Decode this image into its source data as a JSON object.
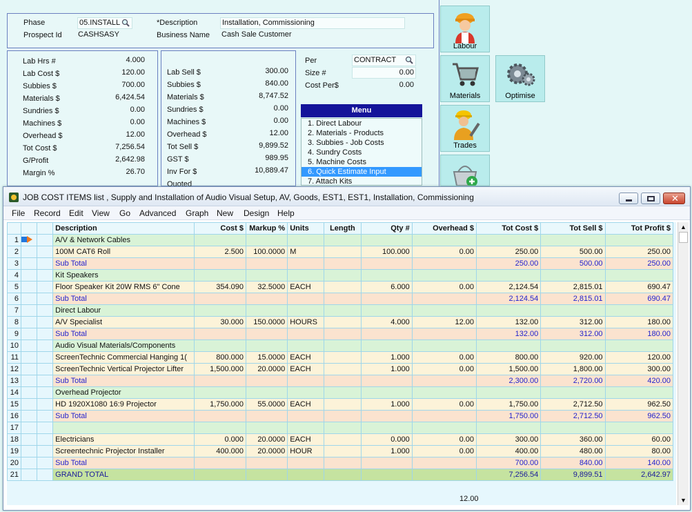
{
  "header": {
    "phase_label": "Phase",
    "phase_value": "05.INSTALL",
    "prospect_label": "Prospect Id",
    "prospect_value": "CASHSASY",
    "desc_label": "*Description",
    "desc_value": "Installation, Commissioning",
    "business_label": "Business Name",
    "business_value": "Cash Sale Customer"
  },
  "costs": [
    {
      "label": "Lab Hrs #",
      "value": "4.000"
    },
    {
      "label": "Lab Cost $",
      "value": "120.00"
    },
    {
      "label": "Subbies  $",
      "value": "700.00"
    },
    {
      "label": "Materials $",
      "value": "6,424.54"
    },
    {
      "label": "Sundries  $",
      "value": "0.00"
    },
    {
      "label": "Machines $",
      "value": "0.00"
    },
    {
      "label": "Overhead $",
      "value": "12.00"
    },
    {
      "label": "Tot Cost $",
      "value": "7,256.54"
    },
    {
      "label": "G/Profit",
      "value": "2,642.98"
    },
    {
      "label": "Margin %",
      "value": "26.70"
    }
  ],
  "sells": [
    {
      "label": "Lab Sell $",
      "value": "300.00"
    },
    {
      "label": "Subbies  $",
      "value": "840.00"
    },
    {
      "label": "Materials $",
      "value": "8,747.52"
    },
    {
      "label": "Sundries  $",
      "value": "0.00"
    },
    {
      "label": "Machines $",
      "value": "0.00"
    },
    {
      "label": "Overhead $",
      "value": "12.00"
    },
    {
      "label": "Tot Sell $",
      "value": "9,899.52"
    },
    {
      "label": "GST  $",
      "value": "989.95"
    },
    {
      "label": "Inv For $",
      "value": "10,889.47"
    },
    {
      "label": "Quoted",
      "value": ""
    }
  ],
  "per": {
    "per_label": "Per",
    "per_value": "CONTRACT",
    "size_label": "Size #",
    "size_value": "0.00",
    "costper_label": "Cost Per$",
    "costper_value": "0.00"
  },
  "menu": {
    "title": "Menu",
    "items": [
      "1. Direct Labour",
      "2. Materials - Products",
      "3. Subbies - Job Costs",
      "4. Sundry Costs",
      "5. Machine Costs",
      "6. Quick Estimate Input",
      "7. Attach Kits"
    ],
    "selected_index": 5
  },
  "side_buttons": {
    "labour": "Labour",
    "materials": "Materials",
    "optimise": "Optimise",
    "trades": "Trades"
  },
  "window": {
    "title": "JOB COST ITEMS list , Supply and Installation of Audio Visual Setup, AV, Goods, EST1, EST1, Installation, Commissioning",
    "menubar": [
      "File",
      "Record",
      "Edit",
      "View",
      "Go",
      "Advanced",
      "Graph",
      "New",
      "Design",
      "Help"
    ]
  },
  "grid": {
    "columns": [
      "Description",
      "Cost $",
      "Markup %",
      "Units",
      "Length",
      "Qty #",
      "Overhead $",
      "Tot Cost $",
      "Tot Sell $",
      "Tot Profit $"
    ],
    "rows": [
      {
        "n": "1",
        "type": "cat",
        "desc": "A/V & Network Cables",
        "cost": "",
        "markup": "",
        "units": "",
        "length": "",
        "qty": "",
        "overhead": "",
        "totcost": "",
        "totsell": "",
        "profit": ""
      },
      {
        "n": "2",
        "type": "item",
        "desc": "100M CAT6 Roll",
        "cost": "2.500",
        "markup": "100.0000",
        "units": "M",
        "length": "",
        "qty": "100.000",
        "overhead": "0.00",
        "totcost": "250.00",
        "totsell": "500.00",
        "profit": "250.00"
      },
      {
        "n": "3",
        "type": "sub",
        "desc": "Sub Total",
        "cost": "",
        "markup": "",
        "units": "",
        "length": "",
        "qty": "",
        "overhead": "",
        "totcost": "250.00",
        "totsell": "500.00",
        "profit": "250.00"
      },
      {
        "n": "4",
        "type": "cat",
        "desc": "Kit Speakers",
        "cost": "",
        "markup": "",
        "units": "",
        "length": "",
        "qty": "",
        "overhead": "",
        "totcost": "",
        "totsell": "",
        "profit": ""
      },
      {
        "n": "5",
        "type": "item",
        "desc": "Floor Speaker Kit 20W RMS 6\" Cone",
        "cost": "354.090",
        "markup": "32.5000",
        "units": "EACH",
        "length": "",
        "qty": "6.000",
        "overhead": "0.00",
        "totcost": "2,124.54",
        "totsell": "2,815.01",
        "profit": "690.47"
      },
      {
        "n": "6",
        "type": "sub",
        "desc": "Sub Total",
        "cost": "",
        "markup": "",
        "units": "",
        "length": "",
        "qty": "",
        "overhead": "",
        "totcost": "2,124.54",
        "totsell": "2,815.01",
        "profit": "690.47"
      },
      {
        "n": "7",
        "type": "cat",
        "desc": "Direct Labour",
        "cost": "",
        "markup": "",
        "units": "",
        "length": "",
        "qty": "",
        "overhead": "",
        "totcost": "",
        "totsell": "",
        "profit": ""
      },
      {
        "n": "8",
        "type": "item",
        "desc": "A/V Specialist",
        "cost": "30.000",
        "markup": "150.0000",
        "units": "HOURS",
        "length": "",
        "qty": "4.000",
        "overhead": "12.00",
        "totcost": "132.00",
        "totsell": "312.00",
        "profit": "180.00"
      },
      {
        "n": "9",
        "type": "sub",
        "desc": "Sub Total",
        "cost": "",
        "markup": "",
        "units": "",
        "length": "",
        "qty": "",
        "overhead": "",
        "totcost": "132.00",
        "totsell": "312.00",
        "profit": "180.00"
      },
      {
        "n": "10",
        "type": "cat",
        "desc": "Audio Visual Materials/Components",
        "cost": "",
        "markup": "",
        "units": "",
        "length": "",
        "qty": "",
        "overhead": "",
        "totcost": "",
        "totsell": "",
        "profit": ""
      },
      {
        "n": "11",
        "type": "item",
        "desc": "ScreenTechnic Commercial Hanging 1(",
        "cost": "800.000",
        "markup": "15.0000",
        "units": "EACH",
        "length": "",
        "qty": "1.000",
        "overhead": "0.00",
        "totcost": "800.00",
        "totsell": "920.00",
        "profit": "120.00"
      },
      {
        "n": "12",
        "type": "item",
        "desc": "ScreenTechnic Vertical Projector Lifter",
        "cost": "1,500.000",
        "markup": "20.0000",
        "units": "EACH",
        "length": "",
        "qty": "1.000",
        "overhead": "0.00",
        "totcost": "1,500.00",
        "totsell": "1,800.00",
        "profit": "300.00"
      },
      {
        "n": "13",
        "type": "sub",
        "desc": "Sub Total",
        "cost": "",
        "markup": "",
        "units": "",
        "length": "",
        "qty": "",
        "overhead": "",
        "totcost": "2,300.00",
        "totsell": "2,720.00",
        "profit": "420.00"
      },
      {
        "n": "14",
        "type": "cat",
        "desc": "Overhead Projector",
        "cost": "",
        "markup": "",
        "units": "",
        "length": "",
        "qty": "",
        "overhead": "",
        "totcost": "",
        "totsell": "",
        "profit": ""
      },
      {
        "n": "15",
        "type": "item",
        "desc": "HD 1920X1080 16:9 Projector",
        "cost": "1,750.000",
        "markup": "55.0000",
        "units": "EACH",
        "length": "",
        "qty": "1.000",
        "overhead": "0.00",
        "totcost": "1,750.00",
        "totsell": "2,712.50",
        "profit": "962.50"
      },
      {
        "n": "16",
        "type": "sub",
        "desc": "Sub Total",
        "cost": "",
        "markup": "",
        "units": "",
        "length": "",
        "qty": "",
        "overhead": "",
        "totcost": "1,750.00",
        "totsell": "2,712.50",
        "profit": "962.50"
      },
      {
        "n": "17",
        "type": "blank",
        "desc": "",
        "cost": "",
        "markup": "",
        "units": "",
        "length": "",
        "qty": "",
        "overhead": "",
        "totcost": "",
        "totsell": "",
        "profit": ""
      },
      {
        "n": "18",
        "type": "item",
        "desc": "Electricians",
        "cost": "0.000",
        "markup": "20.0000",
        "units": "EACH",
        "length": "",
        "qty": "0.000",
        "overhead": "0.00",
        "totcost": "300.00",
        "totsell": "360.00",
        "profit": "60.00"
      },
      {
        "n": "19",
        "type": "item",
        "desc": "Screentechnic Projector Installer",
        "cost": "400.000",
        "markup": "20.0000",
        "units": "HOUR",
        "length": "",
        "qty": "1.000",
        "overhead": "0.00",
        "totcost": "400.00",
        "totsell": "480.00",
        "profit": "80.00"
      },
      {
        "n": "20",
        "type": "sub",
        "desc": "Sub Total",
        "cost": "",
        "markup": "",
        "units": "",
        "length": "",
        "qty": "",
        "overhead": "",
        "totcost": "700.00",
        "totsell": "840.00",
        "profit": "140.00"
      },
      {
        "n": "21",
        "type": "grand",
        "desc": "GRAND TOTAL",
        "cost": "",
        "markup": "",
        "units": "",
        "length": "",
        "qty": "",
        "overhead": "",
        "totcost": "7,256.54",
        "totsell": "9,899.51",
        "profit": "2,642.97"
      }
    ],
    "footer_overhead": "12.00"
  }
}
